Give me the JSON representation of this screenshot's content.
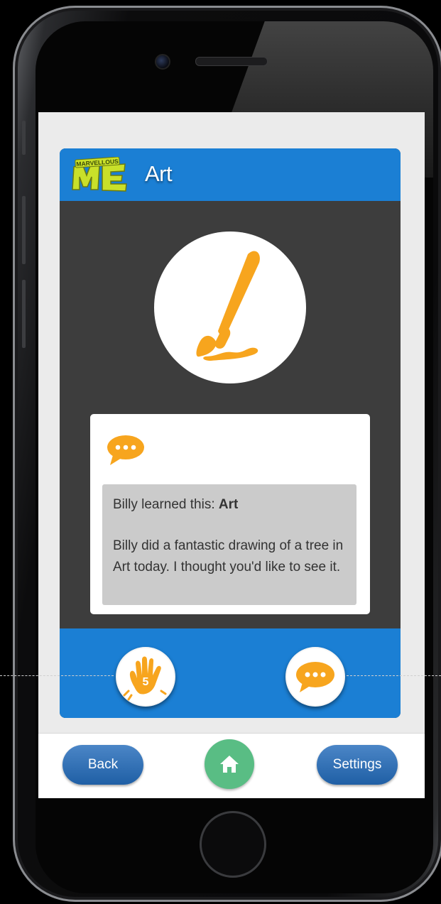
{
  "app": {
    "logo_text_top": "MARVELLOUS",
    "logo_text_main": "ME",
    "title": "Art"
  },
  "message": {
    "learned_prefix": "Billy learned this: ",
    "learned_subject": "Art",
    "body": "Billy did a fantastic drawing of a tree in Art today. I thought you'd like to see it."
  },
  "actions": {
    "high_five_icon": "high-five-hand-icon",
    "comment_icon": "speech-bubble-icon"
  },
  "nav": {
    "back_label": "Back",
    "home_icon": "home-icon",
    "settings_label": "Settings"
  },
  "colors": {
    "header_blue": "#1b7fd4",
    "accent_orange": "#f7a51e",
    "home_green": "#59bd84",
    "card_dark": "#3d3d3d"
  }
}
